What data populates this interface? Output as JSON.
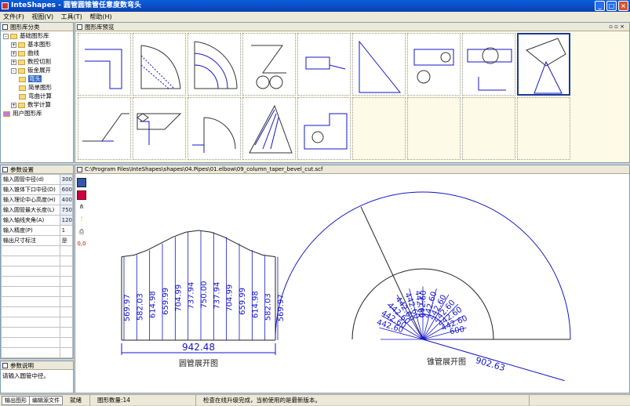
{
  "app": {
    "title": "InteShapes - 圆管圆锥管任意度数弯头"
  },
  "window_buttons": {
    "min": "_",
    "max": "□",
    "close": "×"
  },
  "menu": [
    "文件(F)",
    "视图(V)",
    "工具(T)",
    "帮助(H)"
  ],
  "library_panel": {
    "title": "图形库分类",
    "tree": [
      {
        "label": "基础图形库",
        "level": 0,
        "expander": "-"
      },
      {
        "label": "基本图形",
        "level": 1,
        "expander": "+"
      },
      {
        "label": "曲线",
        "level": 1,
        "expander": "+"
      },
      {
        "label": "数控切割",
        "level": 1,
        "expander": "+"
      },
      {
        "label": "钣金展开",
        "level": 1,
        "expander": "-"
      },
      {
        "label": "弯头",
        "level": 2,
        "selected": true
      },
      {
        "label": "简单图形",
        "level": 2
      },
      {
        "label": "弯曲计算",
        "level": 2
      },
      {
        "label": "数学计算",
        "level": 1,
        "expander": "+"
      },
      {
        "label": "用户图形库",
        "level": 0
      }
    ]
  },
  "preview_panel": {
    "title": "图形库预览"
  },
  "params_panel": {
    "title": "参数设置",
    "rows": [
      {
        "label": "输入圆管中径(d)",
        "value": "300"
      },
      {
        "label": "输入锥体下口中径(D)",
        "value": "600"
      },
      {
        "label": "输入理论中心高度(H)",
        "value": "400"
      },
      {
        "label": "输入圆管最大长度(L)",
        "value": "750"
      },
      {
        "label": "输入轴线夹角(A)",
        "value": "120"
      },
      {
        "label": "输入精度(P)",
        "value": "1"
      },
      {
        "label": "输出尺寸标注",
        "value": "是"
      }
    ]
  },
  "desc_panel": {
    "title": "参数说明",
    "text": "请输入圆管中径。"
  },
  "drawing": {
    "path": "C:\\Program Files\\InteShapes\\shapes\\04.Pipes\\01.elbow\\09_column_taper_bevel_cut.scf",
    "side_tools": [
      "save-icon",
      "copy-icon",
      "tree-icon",
      "marker-icon",
      "print-icon"
    ],
    "side_text": "0,0",
    "pipe_dims": [
      "569.97",
      "582.03",
      "614.98",
      "659.99",
      "704.99",
      "737.94",
      "750.00",
      "737.94",
      "704.99",
      "659.99",
      "614.98",
      "582.03",
      "569.97"
    ],
    "pipe_width": "942.48",
    "pipe_caption": "圆管展开图",
    "cone_labels": [
      "442.60",
      "442.60",
      "442.60",
      "442.60",
      "442.60",
      "442.60",
      "442.60",
      "442.60",
      "442.60",
      "442.60",
      "442.60",
      "442.60",
      "600"
    ],
    "cone_radius": "902.63",
    "cone_caption": "锥管展开图",
    "line_color": "#1515c8"
  },
  "bottom_tabs": [
    "输出图形",
    "编辑源文件"
  ],
  "status": {
    "ready": "就绪",
    "count": "图形数量:14",
    "message": "检查在线升级完成，当前使用的是最新版本。"
  }
}
